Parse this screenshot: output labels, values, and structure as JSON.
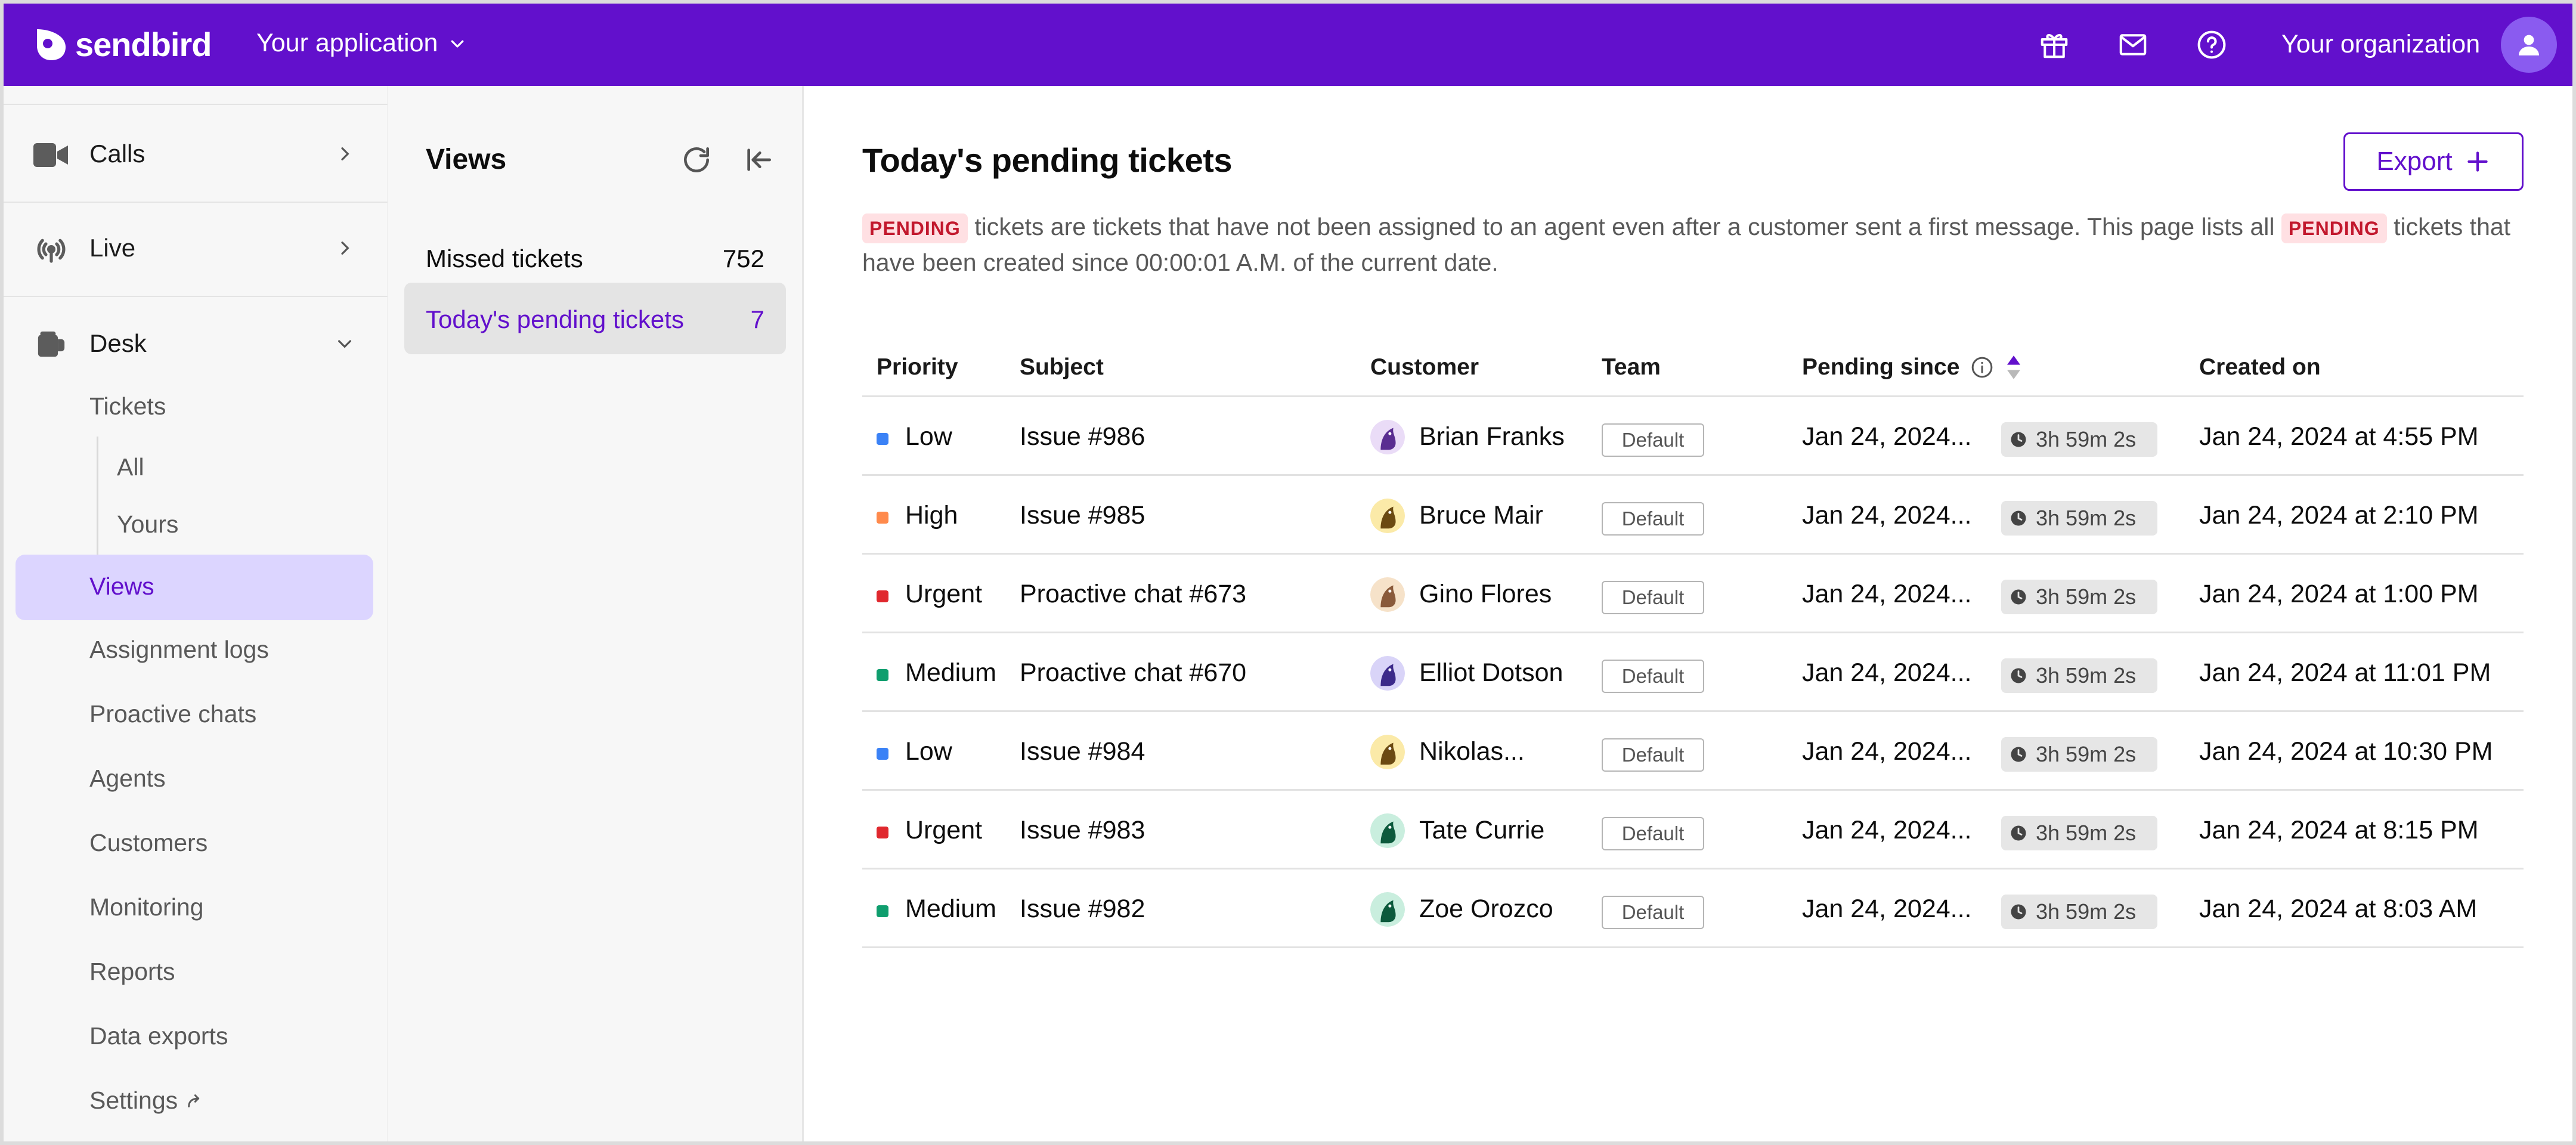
{
  "topbar": {
    "brand": "sendbird",
    "app_selector": "Your application",
    "org_name": "Your organization",
    "icons": [
      "gift-icon",
      "mail-icon",
      "help-icon"
    ]
  },
  "sidebar": {
    "sections": [
      {
        "label": "Calls",
        "icon": "video-camera-icon"
      },
      {
        "label": "Live",
        "icon": "broadcast-icon"
      },
      {
        "label": "Desk",
        "icon": "desk-icon"
      }
    ],
    "desk_items": {
      "tickets": "Tickets",
      "all": "All",
      "yours": "Yours",
      "views": "Views",
      "assignment_logs": "Assignment logs",
      "proactive_chats": "Proactive chats",
      "agents": "Agents",
      "customers": "Customers",
      "monitoring": "Monitoring",
      "reports": "Reports",
      "data_exports": "Data exports",
      "settings": "Settings"
    }
  },
  "views_panel": {
    "title": "Views",
    "items": [
      {
        "label": "Missed tickets",
        "count": "752"
      },
      {
        "label": "Today's pending tickets",
        "count": "7"
      }
    ]
  },
  "main": {
    "title": "Today's pending tickets",
    "export_label": "Export",
    "pending_badge": "PENDING",
    "desc_part1": "tickets are tickets that have not been assigned to an agent even after a customer sent a first message. This page lists all",
    "desc_part2": "tickets that have been created since 00:00:01 A.M. of the current date.",
    "columns": {
      "priority": "Priority",
      "subject": "Subject",
      "customer": "Customer",
      "team": "Team",
      "pending_since": "Pending since",
      "created_on": "Created on"
    },
    "rows": [
      {
        "priority": "Low",
        "priority_color": "#3b82f6",
        "subject": "Issue #986",
        "customer": "Brian Franks",
        "avatar_bg": "#eadcf7",
        "avatar_fg": "#5a2d91",
        "team": "Default",
        "pending": "Jan 24, 2024...",
        "timer": "3h 59m 2s",
        "created": "Jan 24, 2024 at 4:55 PM"
      },
      {
        "priority": "High",
        "priority_color": "#ff8a4c",
        "subject": "Issue #985",
        "customer": "Bruce Mair",
        "avatar_bg": "#fbeaa8",
        "avatar_fg": "#6b4a12",
        "team": "Default",
        "pending": "Jan 24, 2024...",
        "timer": "3h 59m 2s",
        "created": "Jan 24, 2024 at 2:10 PM"
      },
      {
        "priority": "Urgent",
        "priority_color": "#e0282e",
        "subject": "Proactive chat #673",
        "customer": "Gino Flores",
        "avatar_bg": "#f6e2c9",
        "avatar_fg": "#8a5a3a",
        "team": "Default",
        "pending": "Jan 24, 2024...",
        "timer": "3h 59m 2s",
        "created": "Jan 24, 2024 at 1:00 PM"
      },
      {
        "priority": "Medium",
        "priority_color": "#0f9e6e",
        "subject": "Proactive chat #670",
        "customer": "Elliot Dotson",
        "avatar_bg": "#d9d4f8",
        "avatar_fg": "#3c2a8a",
        "team": "Default",
        "pending": "Jan 24, 2024...",
        "timer": "3h 59m 2s",
        "created": "Jan 24, 2024 at 11:01 PM"
      },
      {
        "priority": "Low",
        "priority_color": "#3b82f6",
        "subject": "Issue #984",
        "customer": "Nikolas...",
        "avatar_bg": "#fbeaa8",
        "avatar_fg": "#6b4a12",
        "team": "Default",
        "pending": "Jan 24, 2024...",
        "timer": "3h 59m 2s",
        "created": "Jan 24, 2024 at 10:30 PM"
      },
      {
        "priority": "Urgent",
        "priority_color": "#e0282e",
        "subject": "Issue #983",
        "customer": "Tate Currie",
        "avatar_bg": "#c9eede",
        "avatar_fg": "#0c5a3c",
        "team": "Default",
        "pending": "Jan 24, 2024...",
        "timer": "3h 59m 2s",
        "created": "Jan 24, 2024 at 8:15 PM"
      },
      {
        "priority": "Medium",
        "priority_color": "#0f9e6e",
        "subject": "Issue #982",
        "customer": "Zoe Orozco",
        "avatar_bg": "#c9eede",
        "avatar_fg": "#0c5a3c",
        "team": "Default",
        "pending": "Jan 24, 2024...",
        "timer": "3h 59m 2s",
        "created": "Jan 24, 2024 at 8:03 AM"
      }
    ]
  },
  "colors": {
    "brand_purple": "#6210cc",
    "active_bg": "#dcd5ff",
    "pending_badge_bg": "#ffe0e3",
    "pending_badge_fg": "#c2182d"
  }
}
